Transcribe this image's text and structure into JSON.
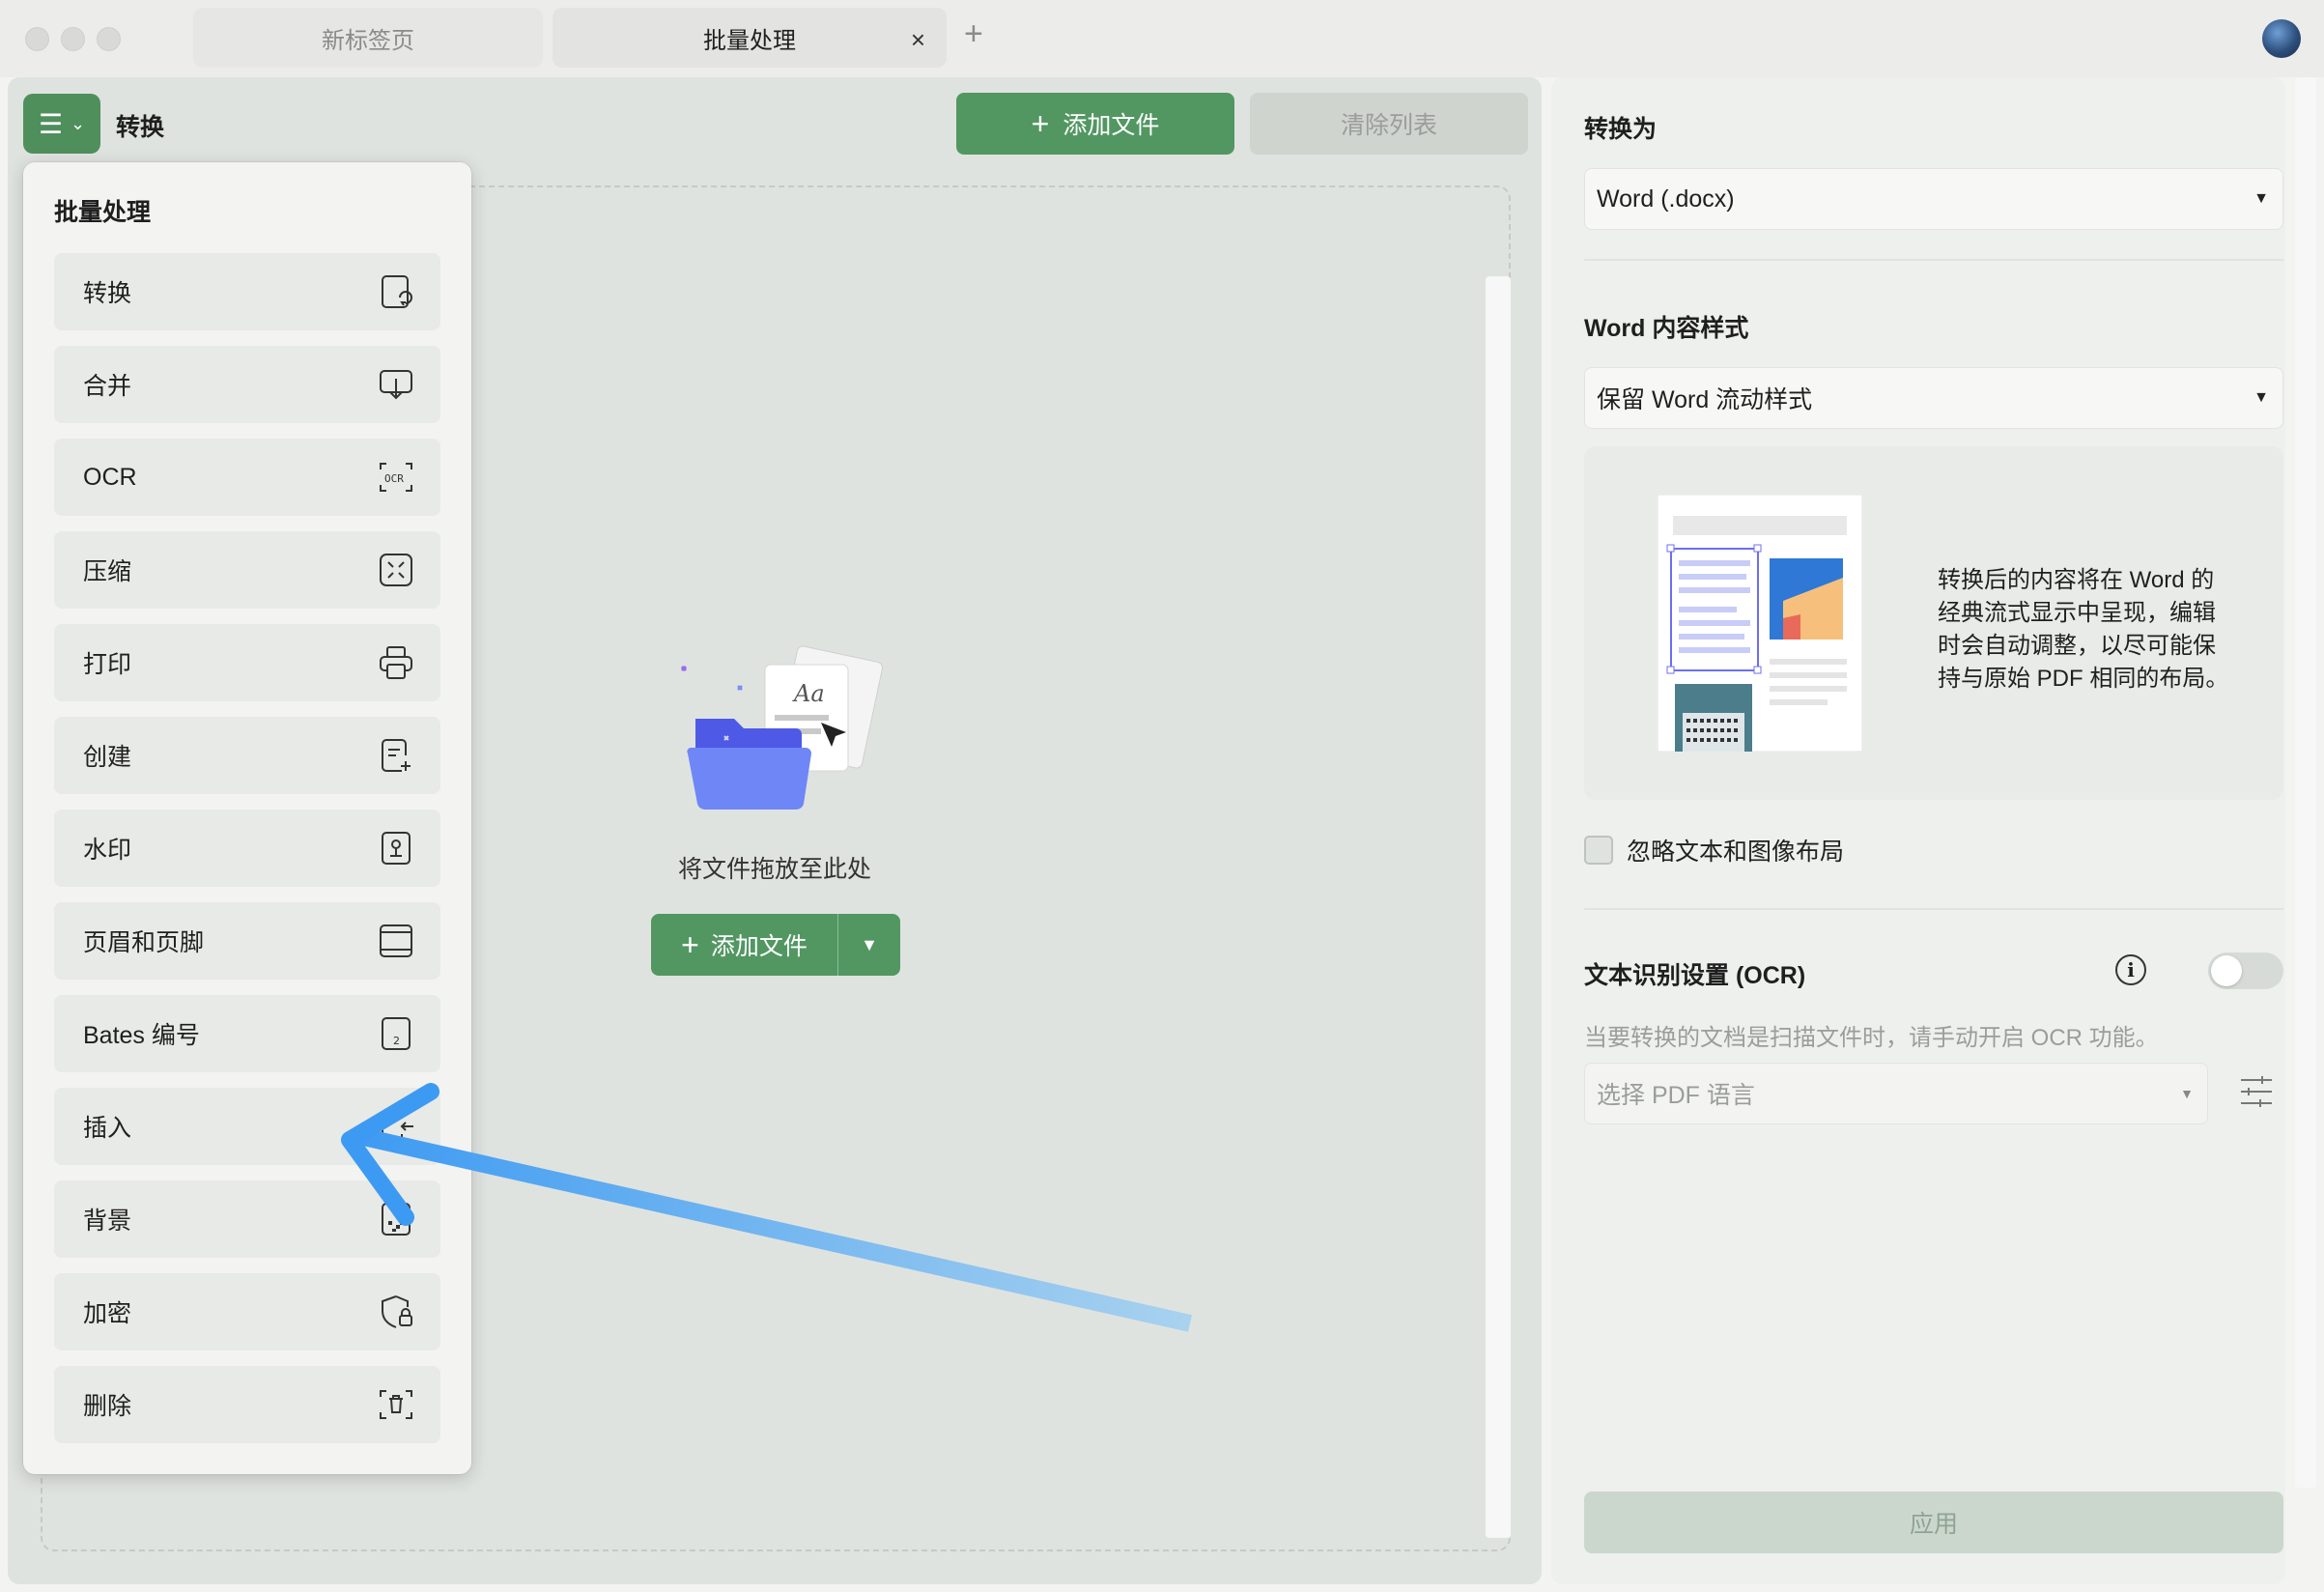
{
  "tabs": [
    {
      "label": "新标签页",
      "active": false
    },
    {
      "label": "批量处理",
      "active": true
    }
  ],
  "toolbar": {
    "title": "转换",
    "add_file": "添加文件",
    "clear_list": "清除列表"
  },
  "dropzone": {
    "text": "将文件拖放至此处",
    "add_file": "添加文件"
  },
  "menu": {
    "heading": "批量处理",
    "items": [
      {
        "label": "转换",
        "icon": "convert-icon"
      },
      {
        "label": "合并",
        "icon": "merge-icon"
      },
      {
        "label": "OCR",
        "icon": "ocr-icon"
      },
      {
        "label": "压缩",
        "icon": "compress-icon"
      },
      {
        "label": "打印",
        "icon": "printer-icon"
      },
      {
        "label": "创建",
        "icon": "create-icon"
      },
      {
        "label": "水印",
        "icon": "watermark-icon"
      },
      {
        "label": "页眉和页脚",
        "icon": "header-footer-icon"
      },
      {
        "label": "Bates 编号",
        "icon": "bates-number-icon"
      },
      {
        "label": "插入",
        "icon": "insert-icon"
      },
      {
        "label": "背景",
        "icon": "background-icon"
      },
      {
        "label": "加密",
        "icon": "encrypt-icon"
      },
      {
        "label": "删除",
        "icon": "delete-icon"
      }
    ]
  },
  "settings": {
    "convert_to_label": "转换为",
    "convert_to_value": "Word (.docx)",
    "word_style_label": "Word 内容样式",
    "word_style_value": "保留 Word 流动样式",
    "preview_description": "转换后的内容将在 Word 的经典流式显示中呈现，编辑时会自动调整，以尽可能保持与原始 PDF 相同的布局。",
    "ignore_layout_label": "忽略文本和图像布局",
    "ignore_layout_checked": false,
    "ocr_label": "文本识别设置 (OCR)",
    "ocr_enabled": false,
    "ocr_hint": "当要转换的文档是扫描文件时，请手动开启 OCR 功能。",
    "language_placeholder": "选择 PDF 语言",
    "apply": "应用"
  },
  "colors": {
    "accent": "#529762",
    "annotation_arrow": "#4a9ff0"
  }
}
